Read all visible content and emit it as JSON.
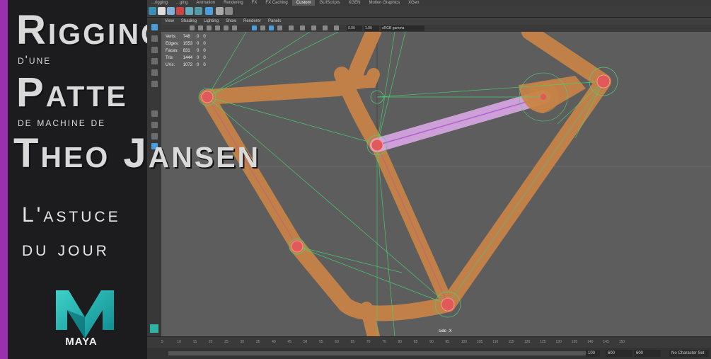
{
  "thumbnail": {
    "title_line1": "Rigging",
    "title_line2": "d'une",
    "title_line3": "Patte",
    "title_line4": "de machine de",
    "title_line5": "Theo Jansen",
    "tagline_line1": "L'astuce",
    "tagline_line2": "du jour",
    "logo_word": "MAYA",
    "accent_color": "#9b2fb0"
  },
  "maya": {
    "menu_tabs": [
      "...rigging",
      "...ging",
      "Animation",
      "Rendering",
      "FX",
      "FX Caching",
      "Custom",
      "GUIScripts",
      "XGEN",
      "Motion Graphics",
      "XGen"
    ],
    "active_tab": "Custom",
    "panel_menu": [
      "View",
      "Shading",
      "Lighting",
      "Show",
      "Renderer",
      "Panels"
    ],
    "hud": {
      "rows": [
        {
          "label": "Verts:",
          "a": "748",
          "b": "0",
          "c": "0"
        },
        {
          "label": "Edges:",
          "a": "1553",
          "b": "0",
          "c": "0"
        },
        {
          "label": "Faces:",
          "a": "831",
          "b": "0",
          "c": "0"
        },
        {
          "label": "Tris:",
          "a": "1444",
          "b": "0",
          "c": "0"
        },
        {
          "label": "UVs:",
          "a": "1072",
          "b": "0",
          "c": "0"
        }
      ]
    },
    "toolbar_value1": "0.00",
    "toolbar_value2": "1.00",
    "color_space": "sRGB gamma",
    "camera_label": "side -X",
    "time_ticks": [
      "5",
      "10",
      "15",
      "20",
      "25",
      "30",
      "35",
      "40",
      "45",
      "50",
      "55",
      "60",
      "65",
      "70",
      "75",
      "80",
      "85",
      "90",
      "95",
      "100",
      "105",
      "110",
      "115",
      "120",
      "125",
      "130",
      "135",
      "140",
      "145",
      "150"
    ],
    "range_start": "100",
    "range_field1": "600",
    "range_field2": "600",
    "character_set": "No Character Set"
  }
}
